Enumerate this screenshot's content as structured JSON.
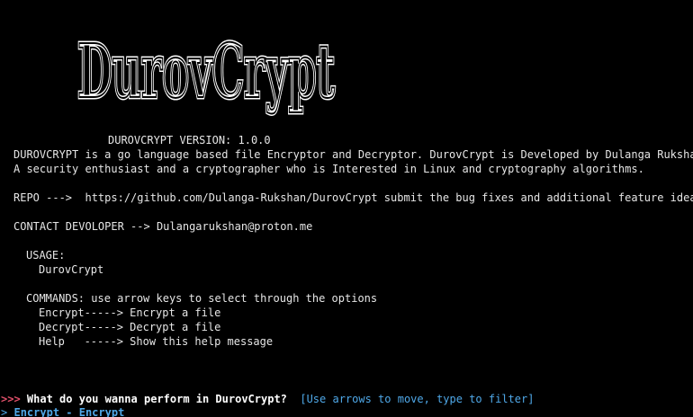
{
  "logo": {
    "text": "DurovCrypt"
  },
  "version_line": "DUROVCRYPT VERSION: 1.0.0",
  "description": [
    "DUROVCRYPT is a go language based file Encryptor and Decryptor. DurovCrypt is Developed by Dulanga Rukshan,",
    "A security enthusiast and a cryptographer who is Interested in Linux and cryptography algorithms."
  ],
  "repo_line": "REPO --->  https://github.com/Dulanga-Rukshan/DurovCrypt submit the bug fixes and additional feature ideas,",
  "contact_line": "CONTACT DEVOLOPER --> Dulangarukshan@proton.me",
  "usage": {
    "heading": "USAGE:",
    "command": "DurovCrypt"
  },
  "commands": {
    "heading": "COMMANDS: use arrow keys to select through the options",
    "items": [
      "Encrypt-----> Encrypt a file",
      "Decrypt-----> Decrypt a file",
      "Help   -----> Show this help message"
    ]
  },
  "prompt": {
    "arrows": ">>>",
    "question": "What do you wanna perform in DurovCrypt?",
    "hint": "[Use arrows to move, type to filter]",
    "selected_marker": ">",
    "selected_option": "Encrypt - Encrypt"
  },
  "colors": {
    "background": "#000000",
    "text": "#e6e6e6",
    "prompt_arrows": "#e0506a",
    "hint": "#4fa8e8"
  }
}
